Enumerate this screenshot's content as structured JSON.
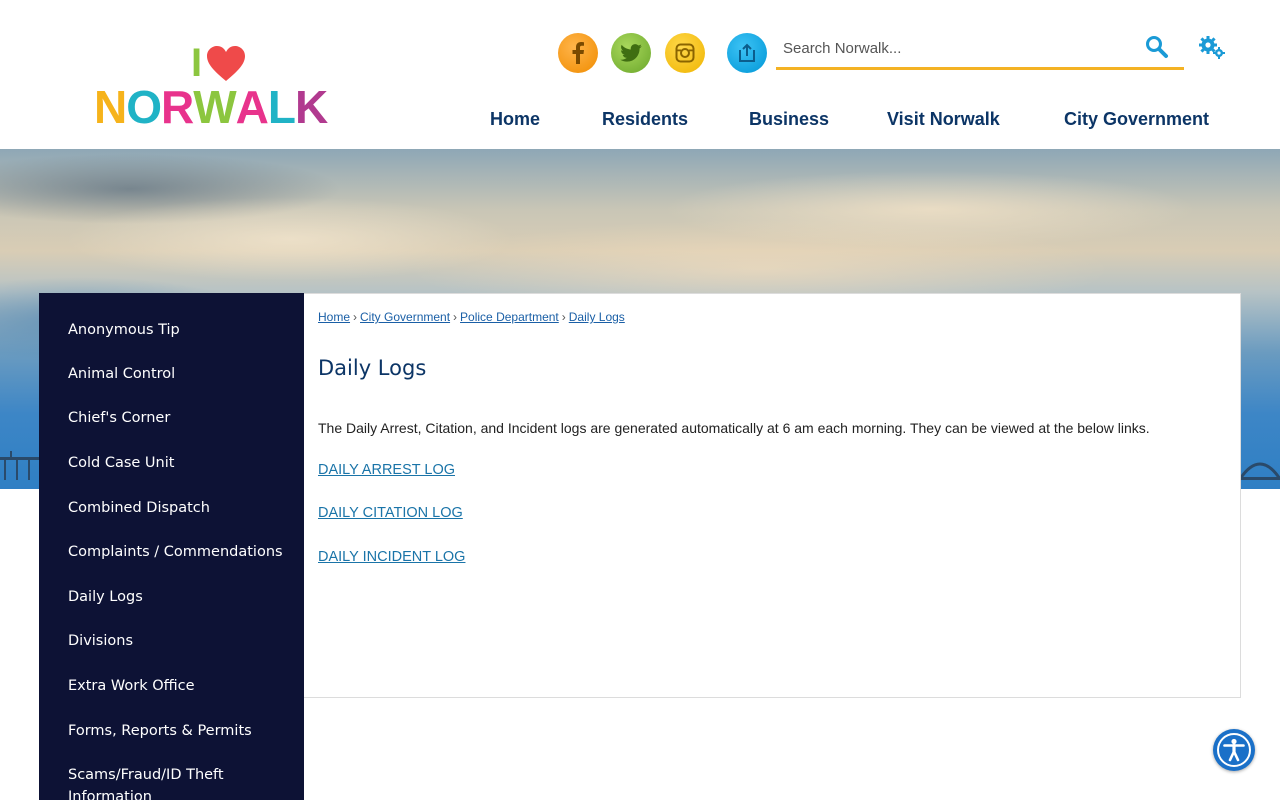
{
  "brand": {
    "logo_top": "I",
    "logo_word_letters": [
      "N",
      "O",
      "R",
      "W",
      "A",
      "L",
      "K"
    ],
    "logo_word_colors": [
      "#f6b31b",
      "#20b3c6",
      "#e8338c",
      "#8cc63f",
      "#e8338c",
      "#20b3c6",
      "#b13a8f"
    ],
    "heart_color": "#ef4a4a",
    "accent_color": "#f4b223",
    "nav_color": "#0c3566",
    "sidebar_color": "#0d1235"
  },
  "header": {
    "social": [
      "facebook-icon",
      "twitter-icon",
      "instagram-icon",
      "share-icon"
    ],
    "search": {
      "placeholder": "Search Norwalk..."
    },
    "nav": [
      "Home",
      "Residents",
      "Business",
      "Visit Norwalk",
      "City Government"
    ]
  },
  "sidebar": {
    "items": [
      "Anonymous Tip",
      "Animal Control",
      "Chief's Corner",
      "Cold Case Unit",
      "Combined Dispatch",
      "Complaints / Commendations",
      "Daily Logs",
      "Divisions",
      "Extra Work Office",
      "Forms, Reports & Permits",
      "Scams/Fraud/ID Theft Information"
    ]
  },
  "content": {
    "breadcrumb": [
      "Home",
      "City Government",
      "Police Department",
      "Daily Logs"
    ],
    "breadcrumb_sep": "›",
    "title": "Daily Logs",
    "intro": "The Daily Arrest, Citation, and Incident logs are generated automatically at 6 am each morning. They can be viewed at the below links.",
    "links": [
      "DAILY ARREST LOG",
      "DAILY CITATION LOG",
      "DAILY INCIDENT LOG"
    ]
  }
}
